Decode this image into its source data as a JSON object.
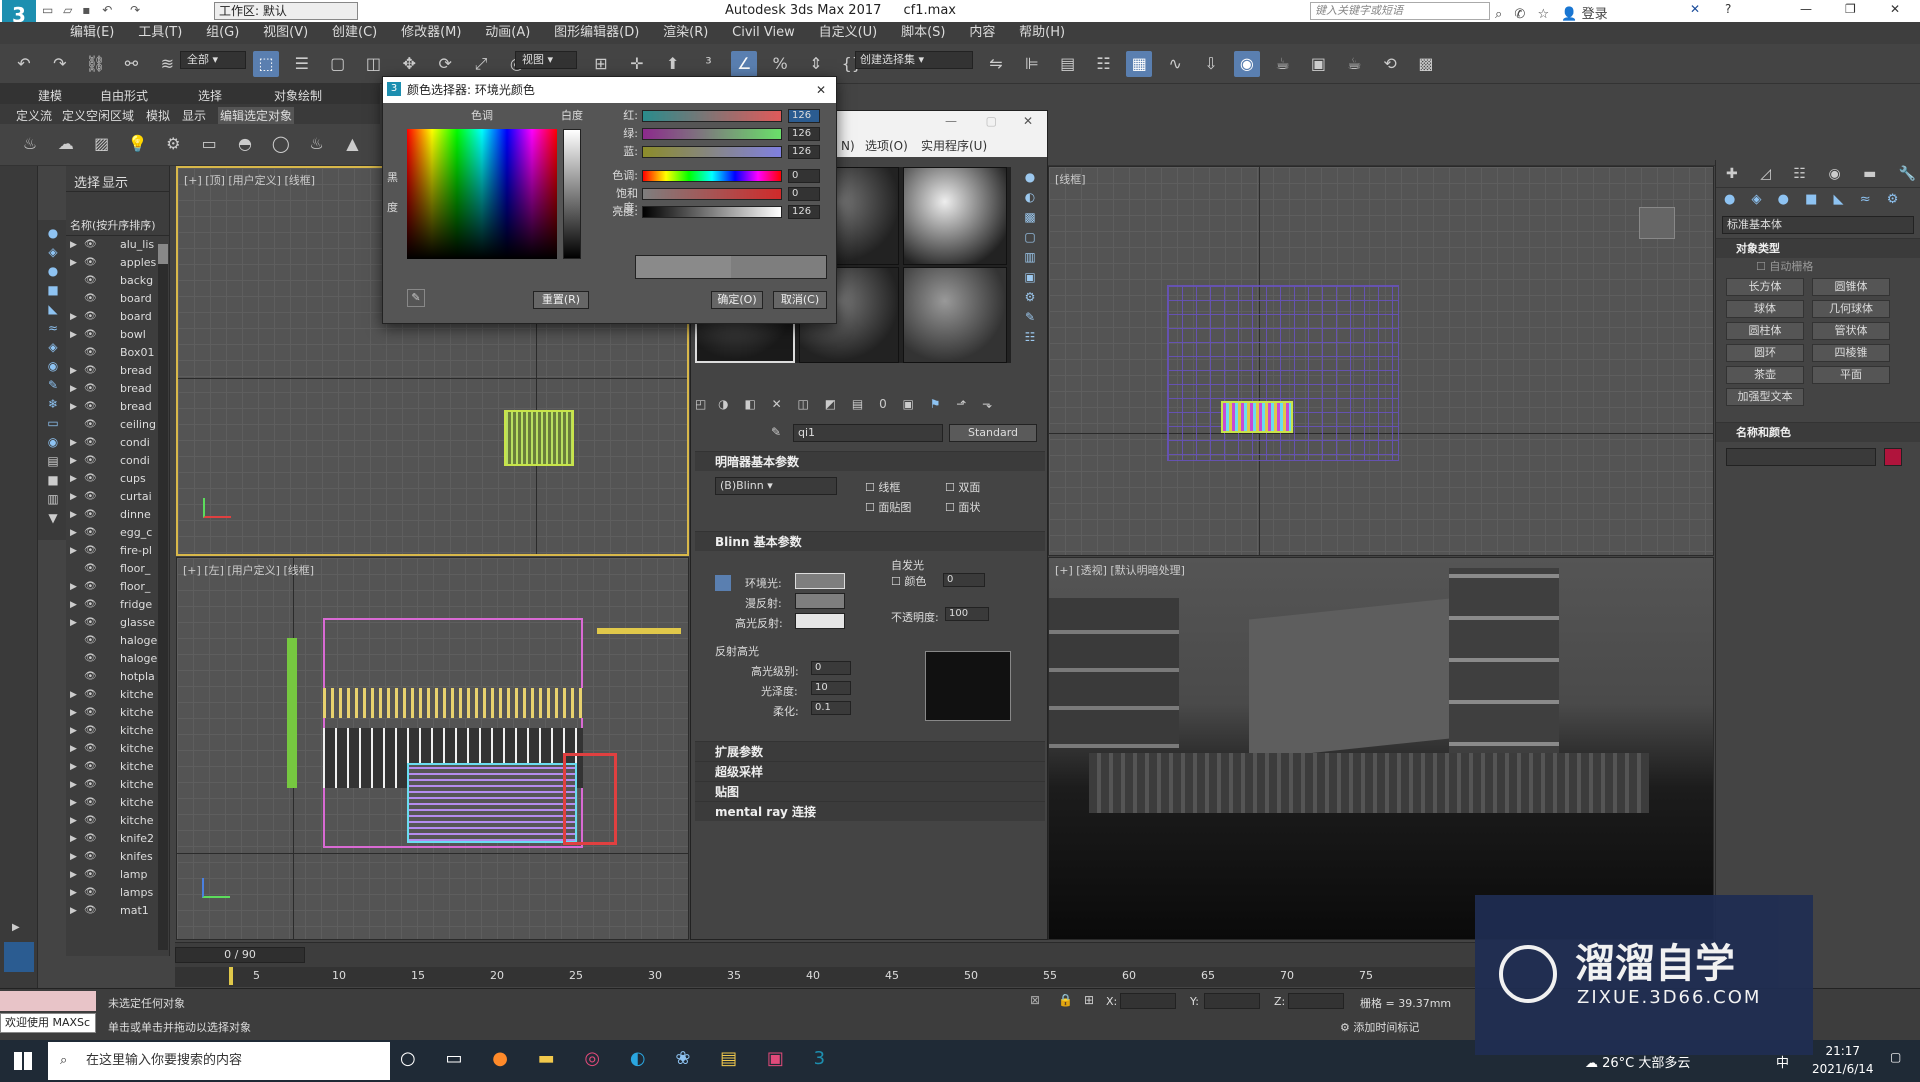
{
  "title_bar": {
    "workspace": "工作区: 默认",
    "app_title": "Autodesk 3ds Max 2017",
    "file_name": "cf1.max",
    "search_placeholder": "键入关键字或短语",
    "login": "登录"
  },
  "menu": [
    "编辑(E)",
    "工具(T)",
    "组(G)",
    "视图(V)",
    "创建(C)",
    "修改器(M)",
    "动画(A)",
    "图形编辑器(D)",
    "渲染(R)",
    "Civil View",
    "自定义(U)",
    "脚本(S)",
    "内容",
    "帮助(H)"
  ],
  "toolbar": {
    "filter": "全部",
    "view_dropdown": "视图",
    "selection_set": "创建选择集"
  },
  "ribbon": {
    "tabs": [
      "建模",
      "自由形式",
      "选择",
      "对象绘制"
    ],
    "sub_tabs": [
      "定义流",
      "定义空闲区域",
      "模拟",
      "显示",
      "编辑选定对象"
    ]
  },
  "scene_explorer": {
    "tabs": [
      "选择",
      "显示"
    ],
    "header": "名称(按升序排序)",
    "items": [
      {
        "name": "alu_lis",
        "expand": true
      },
      {
        "name": "apples",
        "expand": true
      },
      {
        "name": "backg",
        "expand": false
      },
      {
        "name": "board",
        "expand": false
      },
      {
        "name": "board",
        "expand": true
      },
      {
        "name": "bowl",
        "expand": true
      },
      {
        "name": "Box01",
        "expand": false
      },
      {
        "name": "bread",
        "expand": true
      },
      {
        "name": "bread",
        "expand": true
      },
      {
        "name": "bread",
        "expand": true
      },
      {
        "name": "ceiling",
        "expand": false
      },
      {
        "name": "condi",
        "expand": true
      },
      {
        "name": "condi",
        "expand": true
      },
      {
        "name": "cups",
        "expand": true
      },
      {
        "name": "curtai",
        "expand": true
      },
      {
        "name": "dinne",
        "expand": true
      },
      {
        "name": "egg_c",
        "expand": true
      },
      {
        "name": "fire-pl",
        "expand": true
      },
      {
        "name": "floor_",
        "expand": false
      },
      {
        "name": "floor_",
        "expand": true
      },
      {
        "name": "fridge",
        "expand": true
      },
      {
        "name": "glasse",
        "expand": true
      },
      {
        "name": "haloge",
        "expand": false
      },
      {
        "name": "haloge",
        "expand": false
      },
      {
        "name": "hotpla",
        "expand": false
      },
      {
        "name": "kitche",
        "expand": true
      },
      {
        "name": "kitche",
        "expand": true
      },
      {
        "name": "kitche",
        "expand": true
      },
      {
        "name": "kitche",
        "expand": true
      },
      {
        "name": "kitche",
        "expand": true
      },
      {
        "name": "kitche",
        "expand": true
      },
      {
        "name": "kitche",
        "expand": true
      },
      {
        "name": "kitche",
        "expand": true
      },
      {
        "name": "knife2",
        "expand": true
      },
      {
        "name": "knifes",
        "expand": true
      },
      {
        "name": "lamp",
        "expand": true
      },
      {
        "name": "lamps",
        "expand": true
      },
      {
        "name": "mat1",
        "expand": true
      }
    ]
  },
  "viewports": {
    "top": "[+] [顶] [用户定义] [线框]",
    "left": "[+] [左] [用户定义] [线框]",
    "front": "[线框]",
    "persp": "[+] [透视] [默认明暗处理]"
  },
  "color_dialog": {
    "title": "颜色选择器: 环境光颜色",
    "hue_label": "色调",
    "white_label": "白度",
    "black_label": "黑",
    "degree_label": "度",
    "sliders": [
      {
        "label": "红:",
        "value": "126"
      },
      {
        "label": "绿:",
        "value": "126"
      },
      {
        "label": "蓝:",
        "value": "126"
      },
      {
        "label": "色调:",
        "value": "0"
      },
      {
        "label": "饱和度:",
        "value": "0"
      },
      {
        "label": "亮度:",
        "value": "126"
      }
    ],
    "reset_button": "重置(R)",
    "ok_button": "确定(O)",
    "cancel_button": "取消(C)"
  },
  "material_editor": {
    "menu": [
      "N)",
      "选项(O)",
      "实用程序(U)"
    ],
    "material_name": "qi1",
    "material_type": "Standard",
    "shader_rollout": "明暗器基本参数",
    "shader_type": "(B)Blinn",
    "shader_options": [
      "线框",
      "双面",
      "面贴图",
      "面状"
    ],
    "blinn_rollout": "Blinn 基本参数",
    "self_illum": "自发光",
    "color_check": "颜色",
    "self_illum_value": "0",
    "ambient": "环境光:",
    "diffuse": "漫反射:",
    "specular": "高光反射:",
    "opacity_label": "不透明度:",
    "opacity_value": "100",
    "highlights": "反射高光",
    "spec_level_label": "高光级别:",
    "spec_level": "0",
    "gloss_label": "光泽度:",
    "gloss": "10",
    "soften_label": "柔化:",
    "soften": "0.1",
    "rollouts": [
      "扩展参数",
      "超级采样",
      "贴图",
      "mental ray 连接"
    ]
  },
  "command_panel": {
    "dropdown": "标准基本体",
    "object_type": "对象类型",
    "autogrid": "自动栅格",
    "buttons": [
      "长方体",
      "圆锥体",
      "球体",
      "几何球体",
      "圆柱体",
      "管状体",
      "圆环",
      "四棱锥",
      "茶壶",
      "平面",
      "加强型文本"
    ],
    "name_color": "名称和颜色",
    "name_color_swatch": "#b0143c"
  },
  "timeline": {
    "frame": "0 / 90",
    "ticks": [
      "5",
      "10",
      "15",
      "20",
      "25",
      "30",
      "35",
      "40",
      "45",
      "50",
      "55",
      "60",
      "65",
      "70",
      "75"
    ]
  },
  "status": {
    "maxscript": "欢迎使用 MAXSc",
    "line1": "未选定任何对象",
    "line2": "单击或单击并拖动以选择对象",
    "x_label": "X:",
    "y_label": "Y:",
    "z_label": "Z:",
    "grid": "栅格 = 39.37mm",
    "add_time_tag": "添加时间标记"
  },
  "taskbar": {
    "search": "在这里输入你要搜索的内容",
    "weather": "26°C 大部多云",
    "ime": "中",
    "time": "21:17",
    "date": "2021/6/14"
  },
  "watermark": {
    "brand": "溜溜自学",
    "url": "ZIXUE.3D66.COM"
  }
}
